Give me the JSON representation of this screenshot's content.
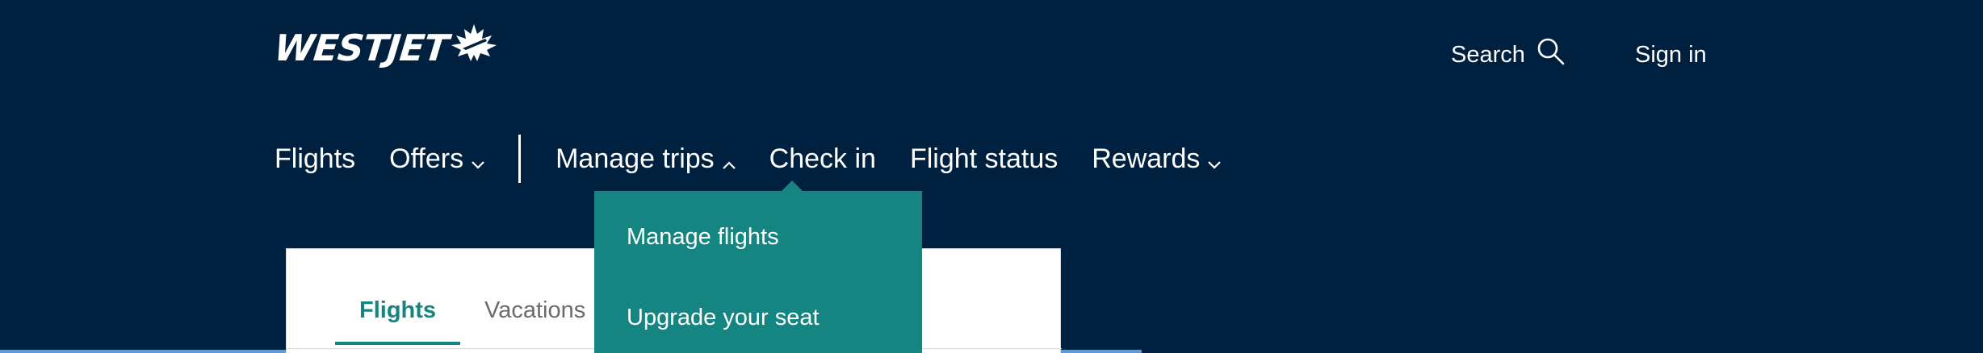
{
  "brand": {
    "logo_text": "WESTJET",
    "logo_icon": "maple-leaf-plane-icon",
    "background_color": "#00203f",
    "accent_color": "#158582"
  },
  "utility_nav": {
    "search_label": "Search",
    "search_icon": "search-icon",
    "signin_label": "Sign in"
  },
  "main_nav": {
    "flights": "Flights",
    "offers": "Offers",
    "manage_trips": "Manage trips",
    "check_in": "Check in",
    "flight_status": "Flight status",
    "rewards": "Rewards"
  },
  "manage_trips_menu": {
    "expanded": true,
    "items": [
      "Manage flights",
      "Upgrade your seat"
    ]
  },
  "booking_widget": {
    "tabs": [
      {
        "label": "Flights",
        "active": true
      },
      {
        "label": "Vacations",
        "active": false
      }
    ]
  }
}
